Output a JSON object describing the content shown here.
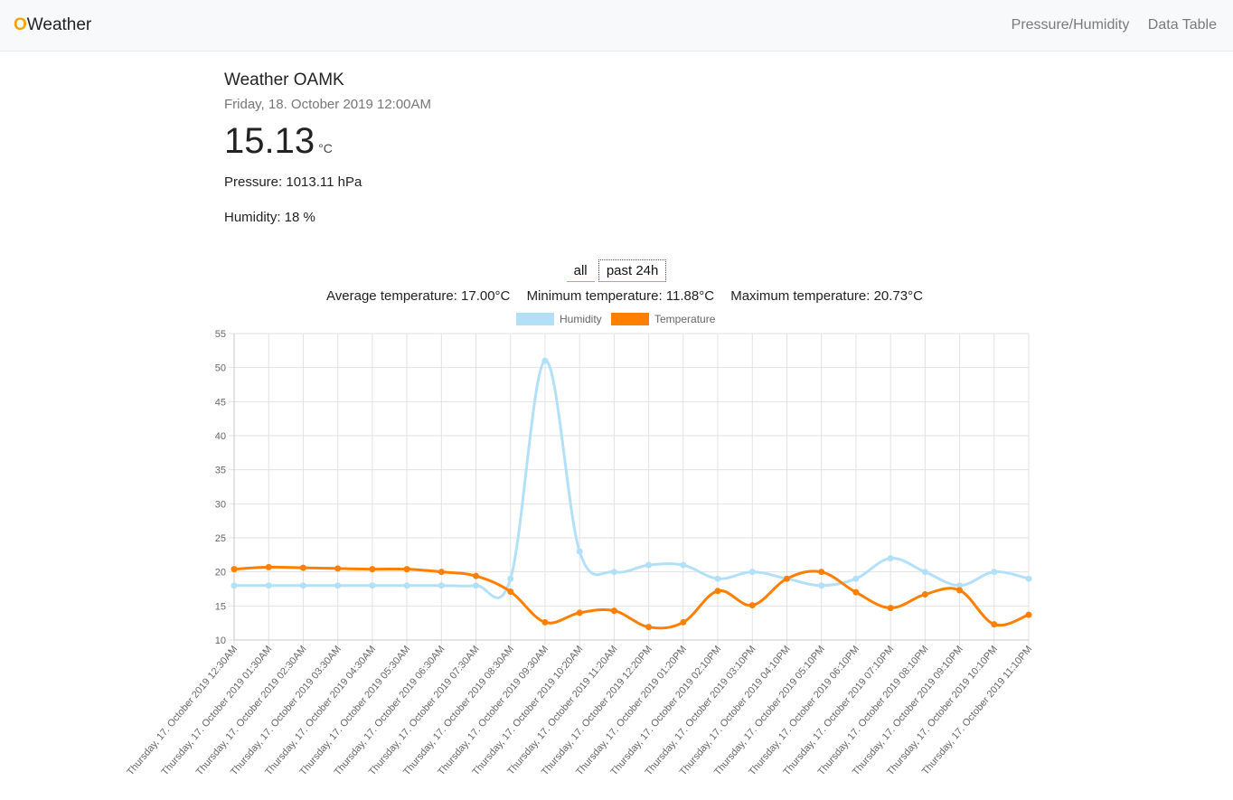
{
  "nav": {
    "brand_o": "O",
    "brand_rest": "Weather",
    "links": [
      "Pressure/Humidity",
      "Data Table"
    ]
  },
  "weather": {
    "title": "Weather OAMK",
    "datetime": "Friday, 18. October 2019 12:00AM",
    "temperature": "15.13",
    "unit": "°C",
    "pressure": "Pressure: 1013.11 hPa",
    "humidity": "Humidity: 18 %"
  },
  "filters": {
    "all": "all",
    "past24": "past 24h"
  },
  "stats": {
    "avg": "Average temperature: 17.00°C",
    "min": "Minimum temperature: 11.88°C",
    "max": "Maximum temperature: 20.73°C"
  },
  "colors": {
    "humidity": "#b3e0f9",
    "temperature": "#ff7f00",
    "accent": "#f0a400"
  },
  "chart_data": {
    "type": "line",
    "categories": [
      "Thursday, 17. October 2019 12:30AM",
      "Thursday, 17. October 2019 01:30AM",
      "Thursday, 17. October 2019 02:30AM",
      "Thursday, 17. October 2019 03:30AM",
      "Thursday, 17. October 2019 04:30AM",
      "Thursday, 17. October 2019 05:30AM",
      "Thursday, 17. October 2019 06:30AM",
      "Thursday, 17. October 2019 07:30AM",
      "Thursday, 17. October 2019 08:30AM",
      "Thursday, 17. October 2019 09:30AM",
      "Thursday, 17. October 2019 10:20AM",
      "Thursday, 17. October 2019 11:20AM",
      "Thursday, 17. October 2019 12:20PM",
      "Thursday, 17. October 2019 01:20PM",
      "Thursday, 17. October 2019 02:10PM",
      "Thursday, 17. October 2019 03:10PM",
      "Thursday, 17. October 2019 04:10PM",
      "Thursday, 17. October 2019 05:10PM",
      "Thursday, 17. October 2019 06:10PM",
      "Thursday, 17. October 2019 07:10PM",
      "Thursday, 17. October 2019 08:10PM",
      "Thursday, 17. October 2019 09:10PM",
      "Thursday, 17. October 2019 10:10PM",
      "Thursday, 17. October 2019 11:10PM"
    ],
    "series": [
      {
        "name": "Humidity",
        "color": "#b3e0f9",
        "values": [
          18,
          18,
          18,
          18,
          18,
          18,
          18,
          18,
          19,
          51,
          23,
          20,
          21,
          21,
          19,
          20,
          19,
          18,
          19,
          22,
          20,
          18,
          20,
          19
        ]
      },
      {
        "name": "Temperature",
        "color": "#ff7f00",
        "values": [
          20.4,
          20.7,
          20.6,
          20.5,
          20.4,
          20.4,
          20.0,
          19.4,
          17.1,
          12.6,
          14.0,
          14.3,
          11.9,
          12.6,
          17.2,
          15.1,
          19.0,
          20.0,
          17.0,
          14.7,
          16.7,
          17.3,
          12.3,
          13.7
        ]
      }
    ],
    "ylim": [
      10,
      55
    ],
    "yticks": [
      10,
      15,
      20,
      25,
      30,
      35,
      40,
      45,
      50,
      55
    ],
    "grid": true,
    "legend": "top"
  }
}
